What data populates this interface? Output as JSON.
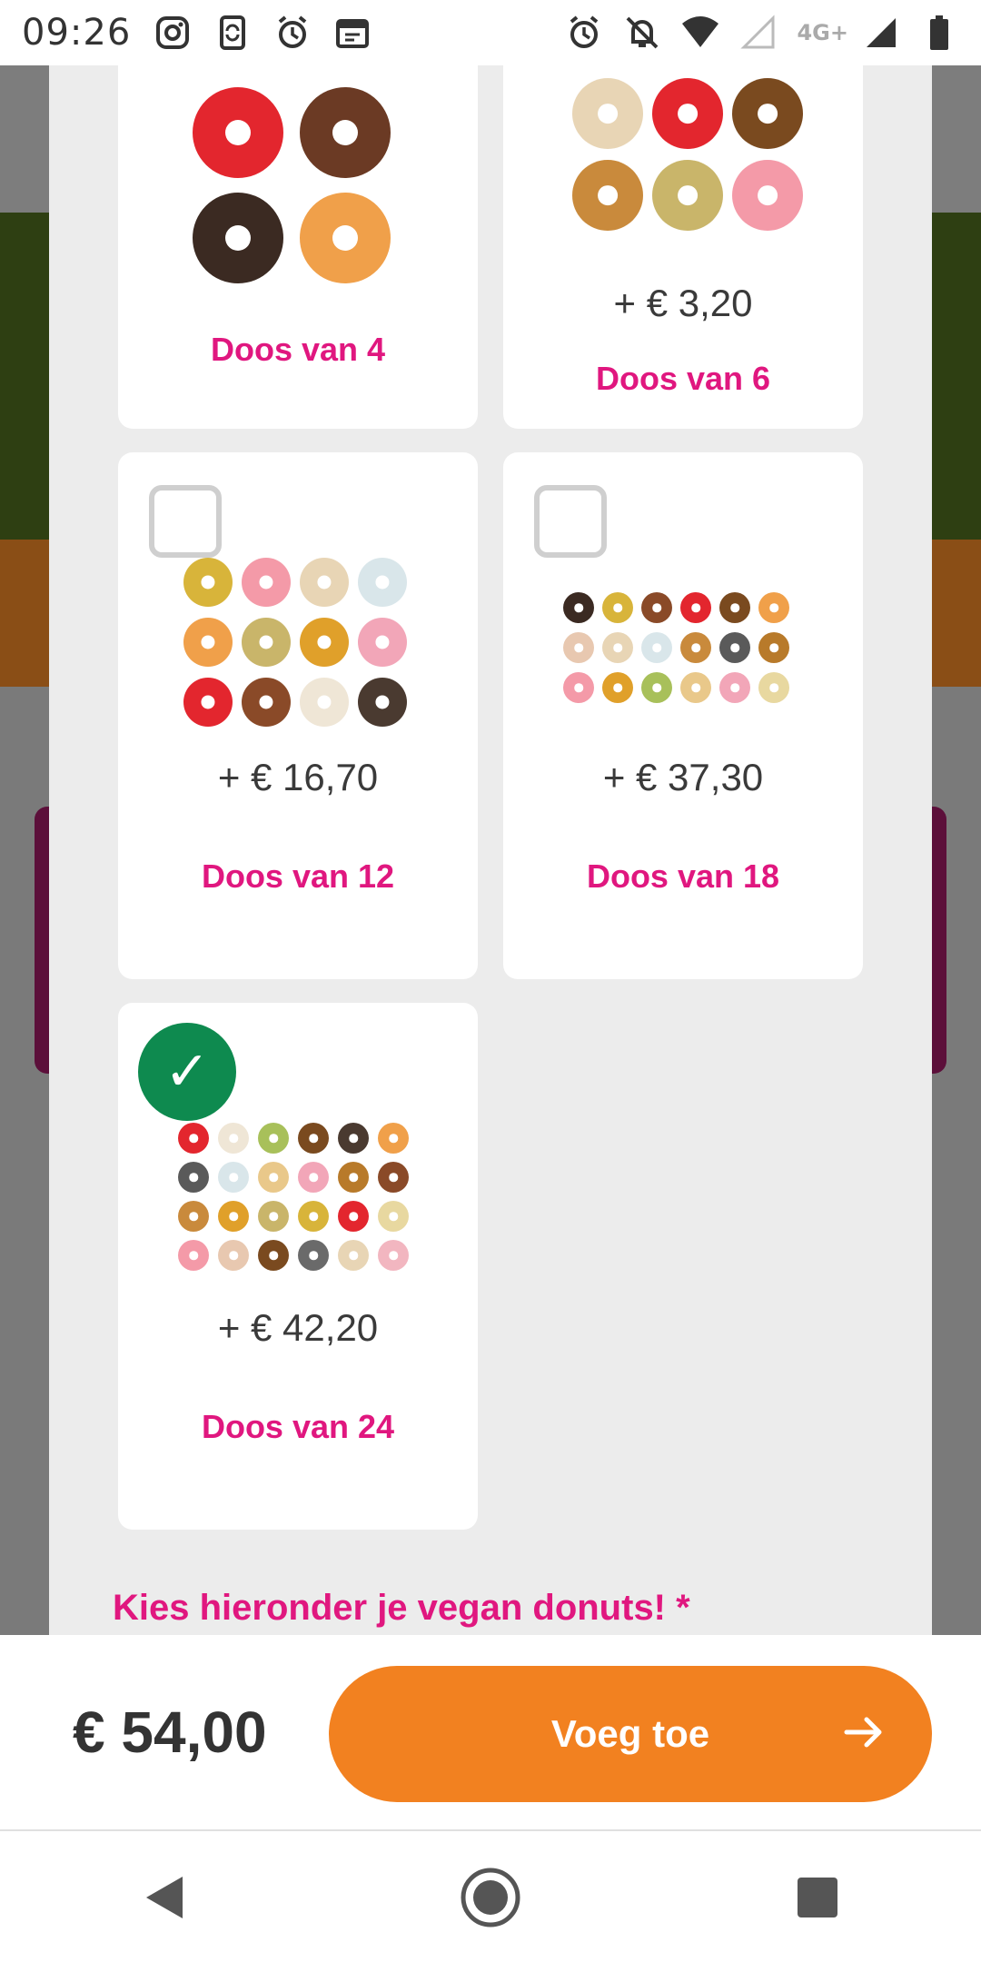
{
  "status_bar": {
    "time": "09:26",
    "network": "4G+",
    "left_icons": [
      "instagram-icon",
      "phone-sync-icon",
      "alarm-icon",
      "calendar-icon"
    ],
    "right_icons": [
      "alarm-icon",
      "notifications-off-icon",
      "wifi-icon",
      "signal-icon",
      "battery-icon"
    ]
  },
  "options": [
    {
      "title": "Doos van 4",
      "price": "",
      "selected": false
    },
    {
      "title": "Doos van 6",
      "price": "+ € 3,20",
      "selected": false
    },
    {
      "title": "Doos van 12",
      "price": "+ € 16,70",
      "selected": false
    },
    {
      "title": "Doos van 18",
      "price": "+ € 37,30",
      "selected": false
    },
    {
      "title": "Doos van 24",
      "price": "+ € 42,20",
      "selected": true
    }
  ],
  "vegan_heading": "Kies hieronder je vegan donuts! *",
  "footer": {
    "total": "€ 54,00",
    "button_label": "Voeg toe"
  },
  "colors": {
    "accent_pink": "#e0177f",
    "button_orange": "#f28120",
    "check_green": "#0e8a4f"
  },
  "navigation": [
    "back-icon",
    "home-icon",
    "recents-icon"
  ]
}
